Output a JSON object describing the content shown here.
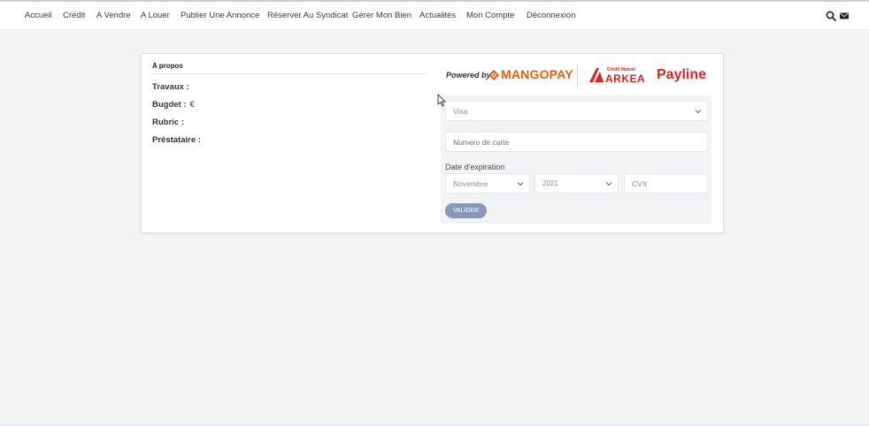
{
  "nav": {
    "items": [
      {
        "label": "Accueil"
      },
      {
        "label": "Crédit"
      },
      {
        "label": "A Vendre"
      },
      {
        "label": "A Louer"
      },
      {
        "label": "Publier Une Annonce"
      },
      {
        "label": "Réserver Au Syndicat"
      },
      {
        "label": "Gérer Mon Bien"
      },
      {
        "label": "Actualités"
      },
      {
        "label": "Mon Compte"
      },
      {
        "label": "Déconnexion"
      }
    ],
    "icons": [
      "search-icon",
      "mail-icon"
    ]
  },
  "about": {
    "title": "A propos",
    "rows": [
      {
        "label": "Travaux :",
        "value": ""
      },
      {
        "label": "Bugdet :",
        "value": "€"
      },
      {
        "label": "Rubric :",
        "value": ""
      },
      {
        "label": "Préstataire :",
        "value": ""
      }
    ]
  },
  "logos": {
    "powered_by": "Powered by",
    "mangopay": "MANGOPAY",
    "arkea_small": "Crédit Mutuel",
    "arkea": "ARKEA",
    "payline": "Payline"
  },
  "payment": {
    "card_type": "Visa",
    "card_number_placeholder": "Numero de carte",
    "expiry_label": "Date d'expiration",
    "month": "Novembre",
    "year": "2021",
    "cvx_placeholder": "CVX",
    "submit_label": "VALIDER"
  },
  "colors": {
    "accent_orange": "#e85d13",
    "brand_red": "#d3261d",
    "button": "#8a97b6",
    "background": "#f2f3f5"
  }
}
